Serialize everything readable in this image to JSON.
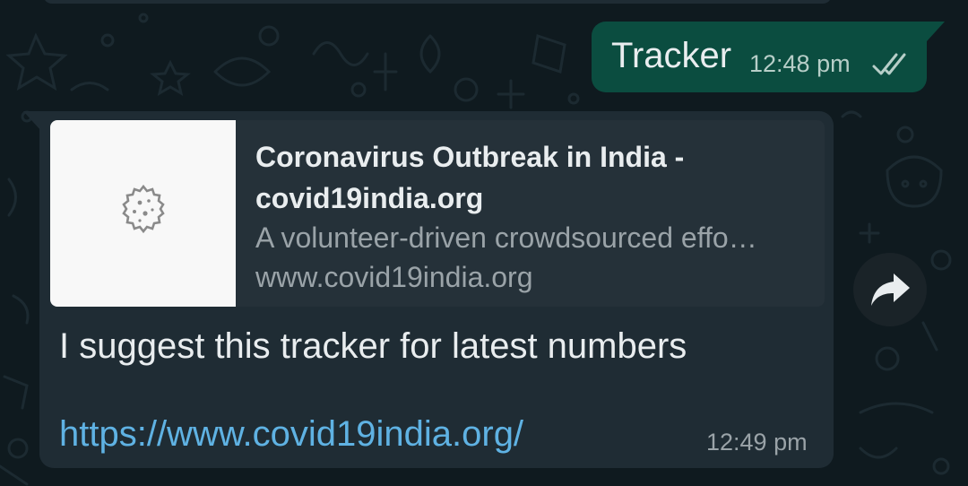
{
  "outgoing": {
    "text": "Tracker",
    "time": "12:48 pm",
    "status_icon": "double-check-icon"
  },
  "incoming": {
    "preview": {
      "thumbnail_icon": "virus-icon",
      "title": "Coronavirus Outbreak in India - covid19india.org",
      "description": "A volunteer-driven crowdsourced effo…",
      "domain": "www.covid19india.org"
    },
    "text": "I suggest this tracker for latest numbers",
    "link": "https://www.covid19india.org/",
    "time": "12:49 pm"
  },
  "forward_button": {
    "icon": "forward-arrow-icon"
  },
  "colors": {
    "background": "#0f1a1f",
    "outgoing_bubble": "#0b4d40",
    "incoming_bubble": "#1f2c34",
    "link": "#5fb2e3"
  }
}
